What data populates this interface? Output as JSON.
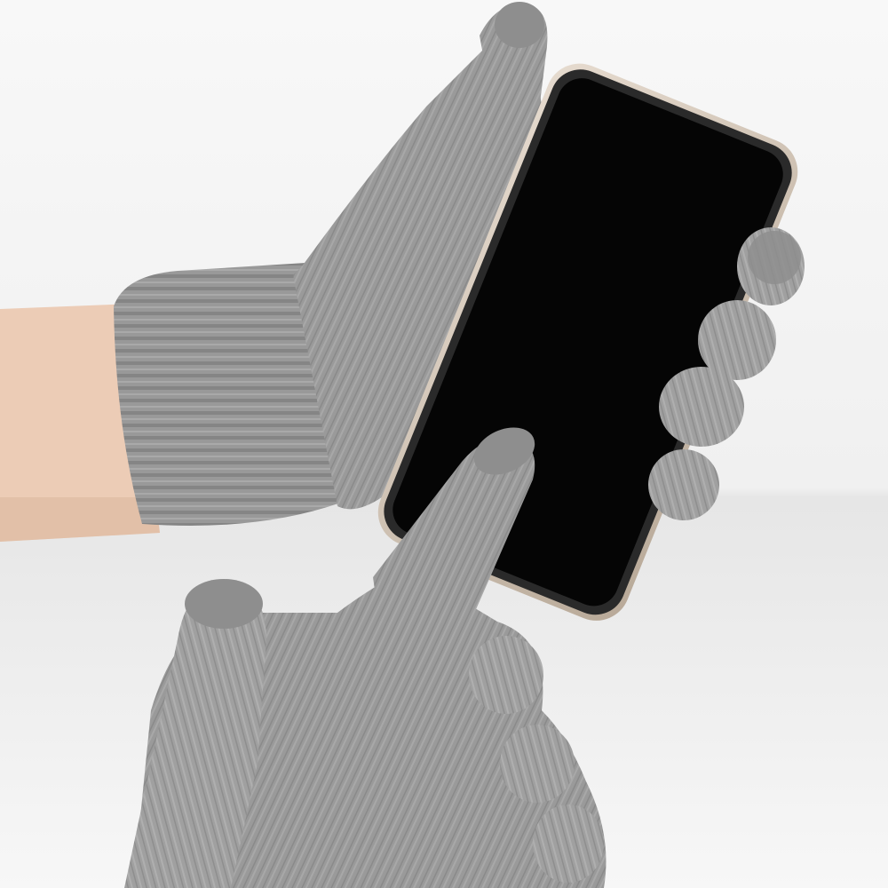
{
  "image": {
    "subject": "",
    "colors": {
      "background": "#f3f3f3",
      "surface": "#fafafa",
      "skin": "#ecccb6",
      "glove": "#9a9a9a",
      "glove_dark": "#7f7f7f",
      "glove_light": "#b4b4b4",
      "touch_tip": "#8e8e8e",
      "phone_body": "#2a2a2a",
      "phone_frame": "#d9cbbd",
      "phone_screen": "#050505"
    }
  }
}
